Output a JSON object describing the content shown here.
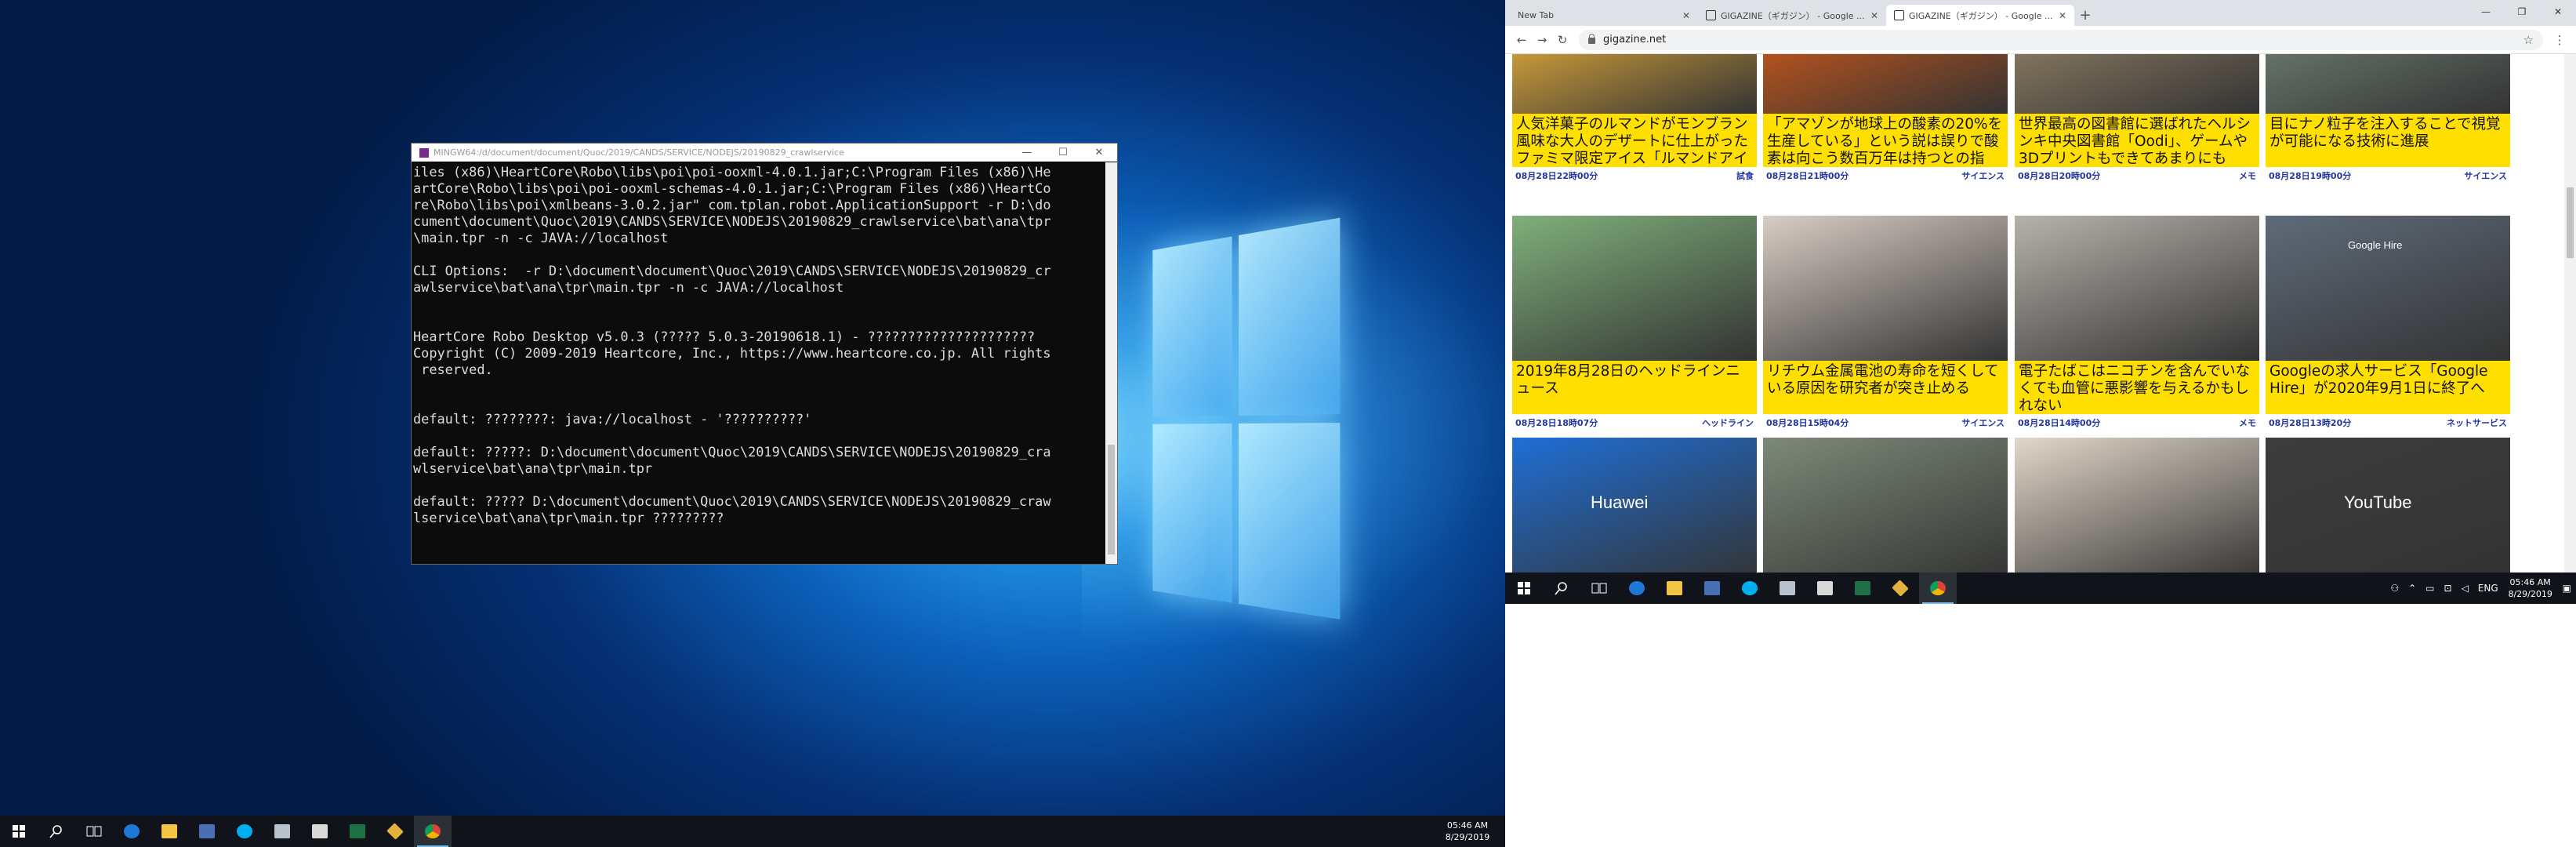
{
  "terminal": {
    "title": "MINGW64:/d/document/document/Quoc/2019/CANDS/SERVICE/NODEJS/20190829_crawlservice",
    "lines": [
      "iles (x86)\\HeartCore\\Robo\\libs\\poi\\poi-ooxml-4.0.1.jar;C:\\Program Files (x86)\\He",
      "artCore\\Robo\\libs\\poi\\poi-ooxml-schemas-4.0.1.jar;C:\\Program Files (x86)\\HeartCo",
      "re\\Robo\\libs\\poi\\xmlbeans-3.0.2.jar\" com.tplan.robot.ApplicationSupport -r D:\\do",
      "cument\\document\\Quoc\\2019\\CANDS\\SERVICE\\NODEJS\\20190829_crawlservice\\bat\\ana\\tpr",
      "\\main.tpr -n -c JAVA://localhost",
      "",
      "CLI Options:  -r D:\\document\\document\\Quoc\\2019\\CANDS\\SERVICE\\NODEJS\\20190829_cr",
      "awlservice\\bat\\ana\\tpr\\main.tpr -n -c JAVA://localhost",
      "",
      "",
      "HeartCore Robo Desktop v5.0.3 (????? 5.0.3-20190618.1) - ?????????????????????",
      "Copyright (C) 2009-2019 Heartcore, Inc., https://www.heartcore.co.jp. All rights",
      " reserved.",
      "",
      "",
      "default: ????????: java://localhost - '??????????'",
      "",
      "default: ?????: D:\\document\\document\\Quoc\\2019\\CANDS\\SERVICE\\NODEJS\\20190829_cra",
      "wlservice\\bat\\ana\\tpr\\main.tpr",
      "",
      "default: ????? D:\\document\\document\\Quoc\\2019\\CANDS\\SERVICE\\NODEJS\\20190829_craw",
      "lservice\\bat\\ana\\tpr\\main.tpr ?????????"
    ]
  },
  "left_taskbar": {
    "time": "05:46 AM",
    "date": "8/29/2019",
    "icons": [
      "start-icon",
      "search-icon",
      "task-view-icon",
      "edge-icon",
      "file-explorer-icon",
      "app-icon",
      "skype-icon",
      "app-icon",
      "app-icon",
      "excel-icon",
      "app-icon",
      "chrome-icon"
    ]
  },
  "browser": {
    "tabs": [
      {
        "label": "New Tab",
        "active": false
      },
      {
        "label": "GIGAZINE（ギガジン） - Google ...",
        "active": false
      },
      {
        "label": "GIGAZINE（ギガジン） - Google ...",
        "active": true
      }
    ],
    "url": "gigazine.net"
  },
  "articles": [
    {
      "title": "人気洋菓子のルマンドがモンブラン風味な大人のデザートに仕上がったファミマ限定アイス「ルマンドアイ",
      "time": "08月28日22時00分",
      "category": "試食",
      "img": "#d9a53a"
    },
    {
      "title": "「アマゾンが地球上の酸素の20%を生産している」という説は誤りで酸素は向こう数百万年は持つとの指",
      "time": "08月28日21時00分",
      "category": "サイエンス",
      "img": "#c2561b"
    },
    {
      "title": "世界最高の図書館に選ばれたヘルシンキ中央図書館「Oodi」、ゲームや3Dプリントもできてあまりにも",
      "time": "08月28日20時00分",
      "category": "メモ",
      "img": "#8c7c63"
    },
    {
      "title": "目にナノ粒子を注入することで視覚が可能になる技術に進展",
      "time": "08月28日19時00分",
      "category": "サイエンス",
      "img": "#6b7a6f"
    },
    {
      "title": "2019年8月28日のヘッドラインニュース",
      "time": "08月28日18時07分",
      "category": "ヘッドライン",
      "img": "#7fb07a"
    },
    {
      "title": "リチウム金属電池の寿命を短くしている原因を研究者が突き止める",
      "time": "08月28日15時04分",
      "category": "サイエンス",
      "img": "#d8cdc4"
    },
    {
      "title": "電子たばこはニコチンを含んでいなくても血管に悪影響を与えるかもしれない",
      "time": "08月28日14時00分",
      "category": "メモ",
      "img": "#b7b2ab"
    },
    {
      "title": "Googleの求人サービス「Google Hire」が2020年9月1日に終了へ",
      "time": "08月28日13時20分",
      "category": "ネットサービス",
      "img": "#5f6b7a"
    },
    {
      "title": "",
      "time": "",
      "category": "",
      "img": "#1f6fd6",
      "overlay": "Huawei"
    },
    {
      "title": "",
      "time": "",
      "category": "",
      "img": "#7d8a78"
    },
    {
      "title": "",
      "time": "",
      "category": "",
      "img": "#e2d7c9"
    },
    {
      "title": "",
      "time": "",
      "category": "",
      "img": "#3c3c3c",
      "overlay": "YouTube"
    }
  ],
  "google_hire_label": "Google Hire",
  "right_taskbar": {
    "time": "05:46 AM",
    "date": "8/29/2019",
    "lang": "ENG"
  }
}
